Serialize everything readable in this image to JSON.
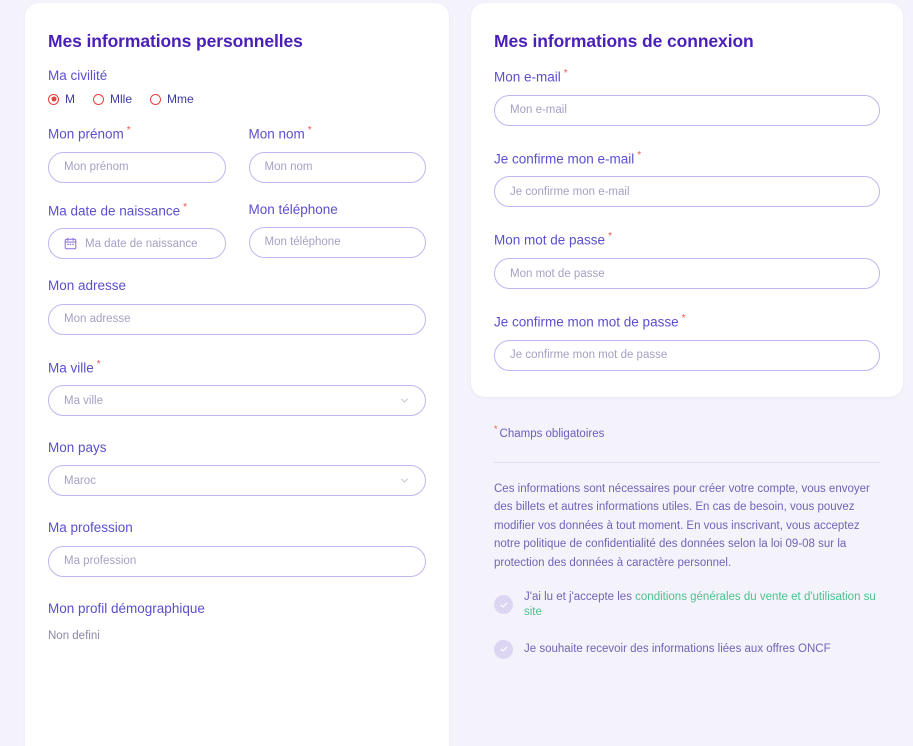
{
  "personal": {
    "title": "Mes informations personnelles",
    "civility": {
      "label": "Ma civilité",
      "options": [
        {
          "label": "M",
          "selected": true
        },
        {
          "label": "Mlle",
          "selected": false
        },
        {
          "label": "Mme",
          "selected": false
        }
      ]
    },
    "fields": {
      "firstname": {
        "label": "Mon prénom",
        "required": true,
        "placeholder": "Mon prénom",
        "value": ""
      },
      "lastname": {
        "label": "Mon nom",
        "required": true,
        "placeholder": "Mon nom",
        "value": ""
      },
      "birthdate": {
        "label": "Ma date de naissance",
        "required": true,
        "placeholder": "Ma date de naissance",
        "value": "",
        "icon": "calendar-icon"
      },
      "phone": {
        "label": "Mon téléphone",
        "required": false,
        "placeholder": "Mon téléphone",
        "value": ""
      },
      "address": {
        "label": "Mon adresse",
        "required": false,
        "placeholder": "Mon adresse",
        "value": ""
      },
      "city": {
        "label": "Ma ville",
        "required": true,
        "placeholder": "Ma ville",
        "value": "",
        "icon": "chevron-down-icon"
      },
      "country": {
        "label": "Mon pays",
        "required": false,
        "placeholder": "Maroc",
        "value": "Maroc",
        "icon": "chevron-down-icon"
      },
      "profession": {
        "label": "Ma profession",
        "required": false,
        "placeholder": "Ma profession",
        "value": ""
      }
    },
    "demographic": {
      "label": "Mon profil démographique",
      "value": "Non defini"
    }
  },
  "connection": {
    "title": "Mes informations de connexion",
    "fields": {
      "email": {
        "label": "Mon e-mail",
        "required": true,
        "placeholder": "Mon e-mail",
        "value": ""
      },
      "email_confirm": {
        "label": "Je confirme mon e-mail",
        "required": true,
        "placeholder": "Je confirme mon e-mail",
        "value": ""
      },
      "password": {
        "label": "Mon mot de passe",
        "required": true,
        "placeholder": "Mon mot de passe",
        "value": ""
      },
      "password_confirm": {
        "label": "Je confirme mon mot de passe",
        "required": true,
        "placeholder": "Je confirme mon mot de passe",
        "value": ""
      }
    }
  },
  "footer": {
    "required_note": "Champs obligatoires",
    "legal_text": "Ces informations sont nécessaires pour créer votre compte, vous envoyer des billets et autres informations utiles. En cas de besoin, vous pouvez modifier vos données à tout moment. En vous inscrivant, vous acceptez notre politique de confidentialité des données selon la loi 09-08 sur la protection des données à caractère personnel.",
    "consents": [
      {
        "text_before": "J'ai lu et j'accepte les",
        "link": "conditions générales du vente et d'utilisation su site",
        "checked": false
      },
      {
        "text_before": "Je souhaite recevoir des informations liées aux offres ONCF",
        "link": "",
        "checked": false
      }
    ]
  },
  "colors": {
    "page_bg": "#f4f2fb",
    "card_bg": "#ffffff",
    "heading": "#4a1fb8",
    "label": "#5b4fcf",
    "required_star": "#f0544f",
    "input_border": "#c3b3f0",
    "placeholder": "#a79fc4",
    "radio_border": "#e8413f",
    "link_green": "#4cc28d",
    "checkbox_bg": "#ddd6f3",
    "divider": "#e3dff3"
  }
}
